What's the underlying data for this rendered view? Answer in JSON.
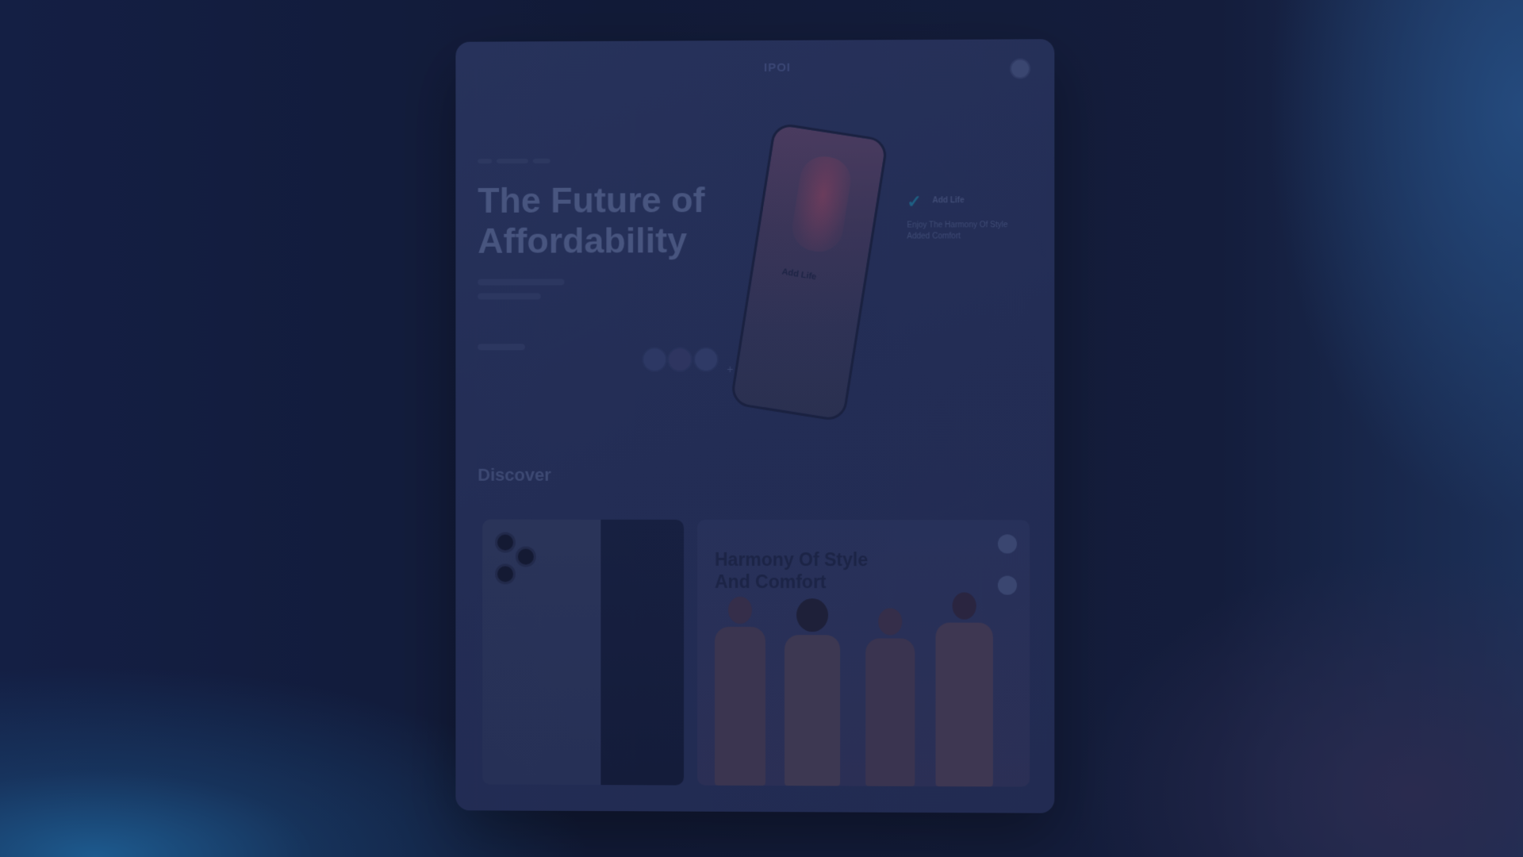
{
  "nav": {
    "links": [
      "",
      "",
      ""
    ],
    "logo": "IPOI"
  },
  "hero": {
    "title": "The Future of Affordability",
    "feature_label": "",
    "colors": [
      "#2d3864",
      "#2e3560",
      "#2f3a66"
    ],
    "phone_label": "Add Life",
    "tag": {
      "label": "Add Life",
      "description": "Enjoy The Harmony Of Style Added Comfort"
    }
  },
  "discover": {
    "heading": "Discover",
    "feature_tile": {
      "tag": "",
      "title": "Harmony Of Style And Comfort"
    }
  }
}
